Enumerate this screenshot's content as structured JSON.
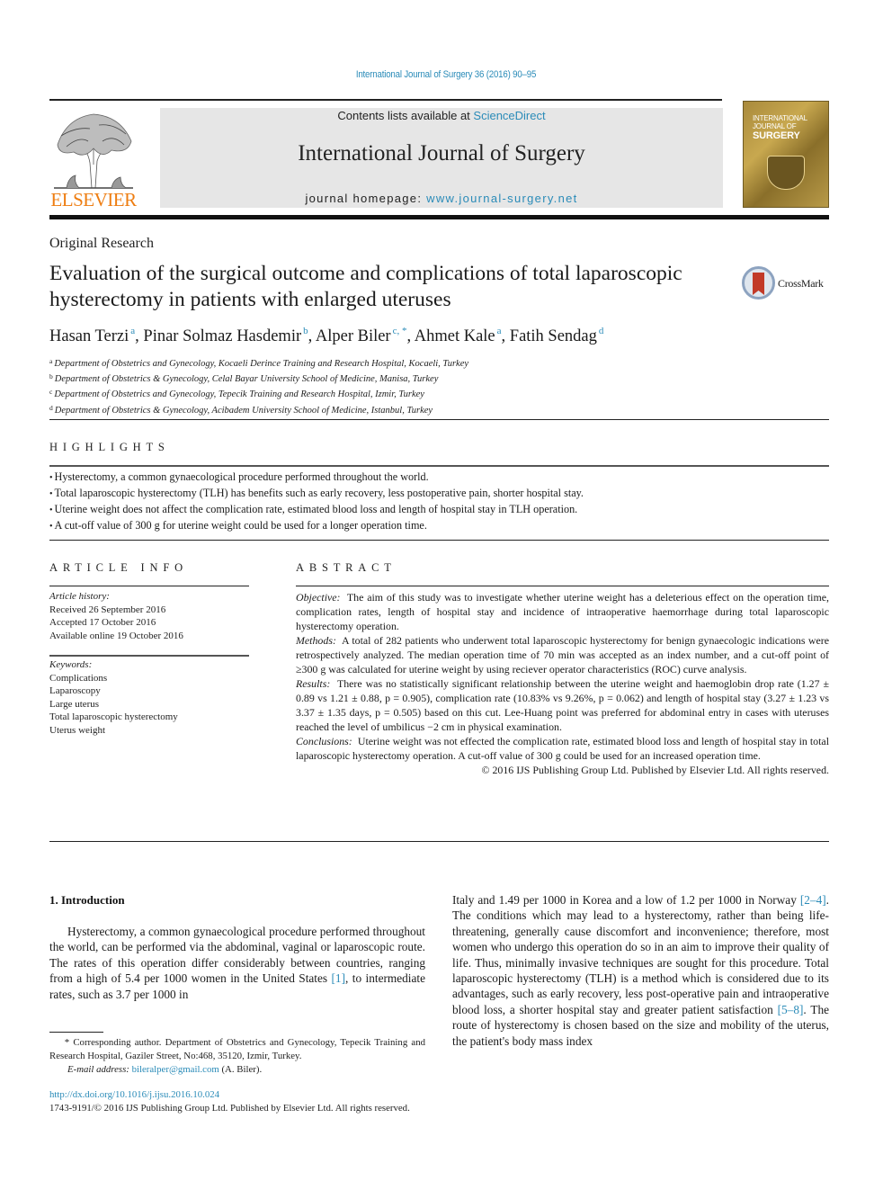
{
  "running_head": "International Journal of Surgery 36 (2016) 90–95",
  "banner": {
    "publisher_wordmark": "ELSEVIER",
    "contents_prefix": "Contents lists available at ",
    "contents_link": "ScienceDirect",
    "journal_title": "International Journal of Surgery",
    "homepage_prefix": "journal homepage: ",
    "homepage_link": "www.journal-surgery.net",
    "cover": {
      "line1": "INTERNATIONAL",
      "line2": "JOURNAL OF",
      "line3": "SURGERY"
    }
  },
  "article": {
    "type": "Original Research",
    "title": "Evaluation of the surgical outcome and complications of total laparoscopic hysterectomy in patients with enlarged uteruses",
    "crossmark_label": "CrossMark",
    "authors": [
      {
        "name": "Hasan Terzi",
        "sup": "a"
      },
      {
        "name": "Pinar Solmaz Hasdemir",
        "sup": "b"
      },
      {
        "name": "Alper Biler",
        "sup": "c, *"
      },
      {
        "name": "Ahmet Kale",
        "sup": "a"
      },
      {
        "name": "Fatih Sendag",
        "sup": "d"
      }
    ],
    "affiliations": [
      {
        "key": "a",
        "text": "Department of Obstetrics and Gynecology, Kocaeli Derince Training and Research Hospital, Kocaeli, Turkey"
      },
      {
        "key": "b",
        "text": "Department of Obstetrics & Gynecology, Celal Bayar University School of Medicine, Manisa, Turkey"
      },
      {
        "key": "c",
        "text": "Department of Obstetrics and Gynecology, Tepecik Training and Research Hospital, Izmir, Turkey"
      },
      {
        "key": "d",
        "text": "Department of Obstetrics & Gynecology, Acibadem University School of Medicine, Istanbul, Turkey"
      }
    ]
  },
  "highlights": {
    "label": "HIGHLIGHTS",
    "items": [
      "Hysterectomy, a common gynaecological procedure performed throughout the world.",
      "Total laparoscopic hysterectomy (TLH) has benefits such as early recovery, less postoperative pain, shorter hospital stay.",
      "Uterine weight does not affect the complication rate, estimated blood loss and length of hospital stay in TLH operation.",
      "A cut-off value of 300 g for uterine weight could be used for a longer operation time."
    ]
  },
  "article_info": {
    "label": "ARTICLE INFO",
    "history_label": "Article history:",
    "history": [
      "Received 26 September 2016",
      "Accepted 17 October 2016",
      "Available online 19 October 2016"
    ],
    "keywords_label": "Keywords:",
    "keywords": [
      "Complications",
      "Laparoscopy",
      "Large uterus",
      "Total laparoscopic hysterectomy",
      "Uterus weight"
    ]
  },
  "abstract": {
    "label": "ABSTRACT",
    "sections": [
      {
        "heading": "Objective:",
        "text": "The aim of this study was to investigate whether uterine weight has a deleterious effect on the operation time, complication rates, length of hospital stay and incidence of intraoperative haemorrhage during total laparoscopic hysterectomy operation."
      },
      {
        "heading": "Methods:",
        "text": "A total of 282 patients who underwent total laparoscopic hysterectomy for benign gynaecologic indications were retrospectively analyzed. The median operation time of 70 min was accepted as an index number, and a cut-off point of ≥300 g was calculated for uterine weight by using reciever operator characteristics (ROC) curve analysis."
      },
      {
        "heading": "Results:",
        "text": "There was no statistically significant relationship between the uterine weight and haemoglobin drop rate (1.27 ± 0.89 vs 1.21 ± 0.88, p = 0.905), complication rate (10.83% vs 9.26%, p = 0.062) and length of hospital stay (3.27 ± 1.23 vs 3.37 ± 1.35 days, p = 0.505) based on this cut. Lee-Huang point was preferred for abdominal entry in cases with uteruses reached the level of umbilicus −2 cm in physical examination."
      },
      {
        "heading": "Conclusions:",
        "text": "Uterine weight was not effected the complication rate, estimated blood loss and length of hospital stay in total laparoscopic hysterectomy operation. A cut-off value of 300 g could be used for an increased operation time."
      }
    ],
    "copyright": "© 2016 IJS Publishing Group Ltd. Published by Elsevier Ltd. All rights reserved."
  },
  "introduction": {
    "heading": "1.  Introduction",
    "left_column": [
      {
        "text": "Hysterectomy, a common gynaecological procedure performed throughout the world, can be performed via the abdominal, vaginal or laparoscopic route. The rates of this operation differ considerably between countries, ranging from a high of 5.4 per 1000 women in the United States "
      },
      {
        "ref": "[1]"
      },
      {
        "text": ", to intermediate rates, such as 3.7 per 1000 in"
      }
    ],
    "right_column": [
      {
        "text": "Italy and 1.49 per 1000 in Korea and a low of 1.2 per 1000 in Norway "
      },
      {
        "ref": "[2–4]"
      },
      {
        "text": ". The conditions which may lead to a hysterectomy, rather than being life-threatening, generally cause discomfort and inconvenience; therefore, most women who undergo this operation do so in an aim to improve their quality of life. Thus, minimally invasive techniques are sought for this procedure. Total laparoscopic hysterectomy (TLH) is a method which is considered due to its advantages, such as early recovery, less post-operative pain and intraoperative blood loss, a shorter hospital stay and greater patient satisfaction "
      },
      {
        "ref": "[5–8]"
      },
      {
        "text": ". The route of hysterectomy is chosen based on the size and mobility of the uterus, the patient's body mass index"
      }
    ]
  },
  "footnote": {
    "corresponding": "* Corresponding author. Department of Obstetrics and Gynecology, Tepecik Training and Research Hospital, Gaziler Street, No:468, 35120, Izmir, Turkey.",
    "email_label": "E-mail address:",
    "email": "bileralper@gmail.com",
    "email_suffix": " (A. Biler)."
  },
  "doi": "http://dx.doi.org/10.1016/j.ijsu.2016.10.024",
  "issn_line": "1743-9191/© 2016 IJS Publishing Group Ltd. Published by Elsevier Ltd. All rights reserved.",
  "colors": {
    "link": "#2a8bb8",
    "elsevier_orange": "#ee7d11",
    "banner_bg": "#e6e6e6",
    "crossmark_red": "#c23a28"
  }
}
